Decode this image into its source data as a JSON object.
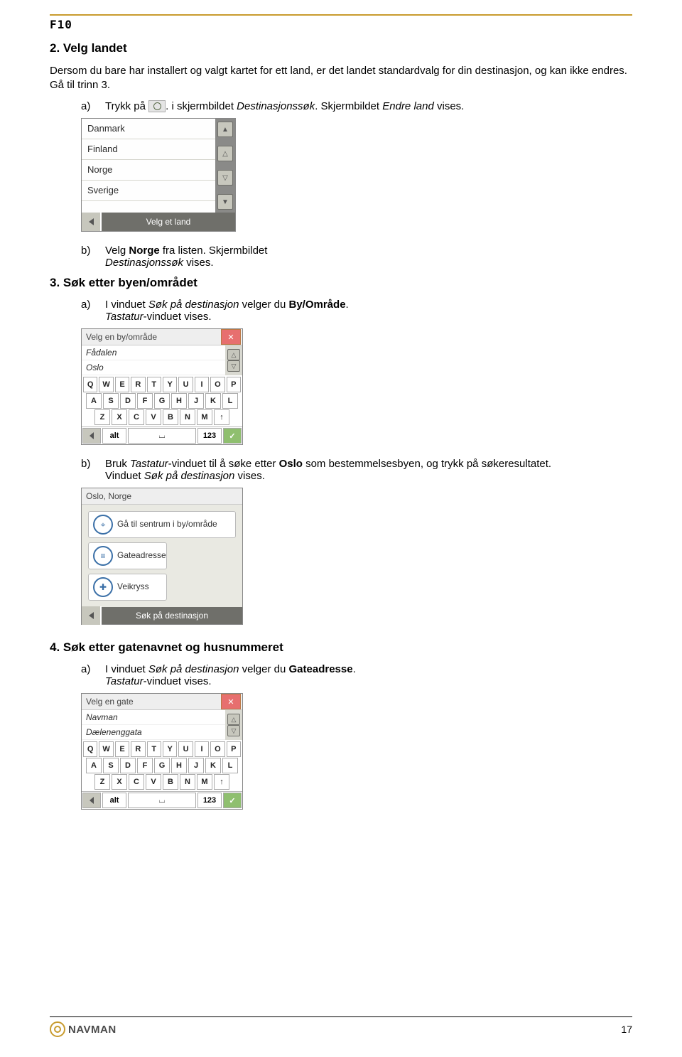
{
  "header": {
    "model": "F10"
  },
  "section2": {
    "heading": "2. Velg landet",
    "intro": "Dersom du bare har installert og valgt kartet for ett land, er det landet standardvalg for din destinasjon, og kan ikke endres. Gå til trinn 3.",
    "a": {
      "label": "a)",
      "pre": "Trykk på ",
      "post": ". i skjermbildet ",
      "italic1": "Destinasjonssøk",
      "mid": ". Skjermbildet ",
      "italic2": "Endre land",
      "end": " vises."
    },
    "b": {
      "label": "b)",
      "t1": "Velg ",
      "bold": "Norge",
      "t2": " fra listen. Skjermbildet",
      "line2_italic": "Destinasjonssøk",
      "line2_end": " vises."
    }
  },
  "shot1": {
    "items": [
      "Danmark",
      "Finland",
      "Norge",
      "Sverige"
    ],
    "footer": "Velg et land"
  },
  "section3": {
    "heading": "3. Søk etter byen/området",
    "a": {
      "label": "a)",
      "t1": "I vinduet ",
      "italic1": "Søk på destinasjon",
      "t2": " velger du ",
      "bold": "By/Område",
      "t3": ".",
      "line2_italic": "Tastatur",
      "line2_end": "-vinduet vises."
    },
    "b": {
      "label": "b)",
      "t1": "Bruk ",
      "italic1": "Tastatur",
      "t2": "-vinduet til å søke etter ",
      "bold": "Oslo",
      "t3": " som bestemmelsesbyen, og trykk på søkeresultatet.",
      "line2_t1": "Vinduet ",
      "line2_italic": "Søk på destinasjon",
      "line2_end": " vises."
    }
  },
  "kshot1": {
    "title": "Velg en by/område",
    "results": [
      "Fådalen",
      "Oslo"
    ],
    "rows": [
      [
        "Q",
        "W",
        "E",
        "R",
        "T",
        "Y",
        "U",
        "I",
        "O",
        "P"
      ],
      [
        "A",
        "S",
        "D",
        "F",
        "G",
        "H",
        "J",
        "K",
        "L"
      ],
      [
        "Z",
        "X",
        "C",
        "V",
        "B",
        "N",
        "M",
        "↑"
      ]
    ],
    "alt": "alt",
    "space": "⌴",
    "num": "123",
    "ok": "✓"
  },
  "dshot": {
    "title": "Oslo, Norge",
    "cards": {
      "center": "Gå til sentrum i by/område",
      "street": "Gateadresse",
      "cross": "Veikryss"
    },
    "footer": "Søk på destinasjon"
  },
  "section4": {
    "heading": "4. Søk etter gatenavnet og husnummeret",
    "a": {
      "label": "a)",
      "t1": "I vinduet ",
      "italic1": "Søk på destinasjon",
      "t2": " velger du ",
      "bold": "Gateadresse",
      "t3": ".",
      "line2_italic": "Tastatur",
      "line2_end": "-vinduet vises."
    }
  },
  "kshot2": {
    "title": "Velg en gate",
    "results": [
      "Navman",
      "Dælenenggata"
    ],
    "rows": [
      [
        "Q",
        "W",
        "E",
        "R",
        "T",
        "Y",
        "U",
        "I",
        "O",
        "P"
      ],
      [
        "A",
        "S",
        "D",
        "F",
        "G",
        "H",
        "J",
        "K",
        "L"
      ],
      [
        "Z",
        "X",
        "C",
        "V",
        "B",
        "N",
        "M",
        "↑"
      ]
    ],
    "alt": "alt",
    "space": "⌴",
    "num": "123",
    "ok": "✓"
  },
  "footer": {
    "brand": "NAVMAN",
    "page": "17"
  }
}
